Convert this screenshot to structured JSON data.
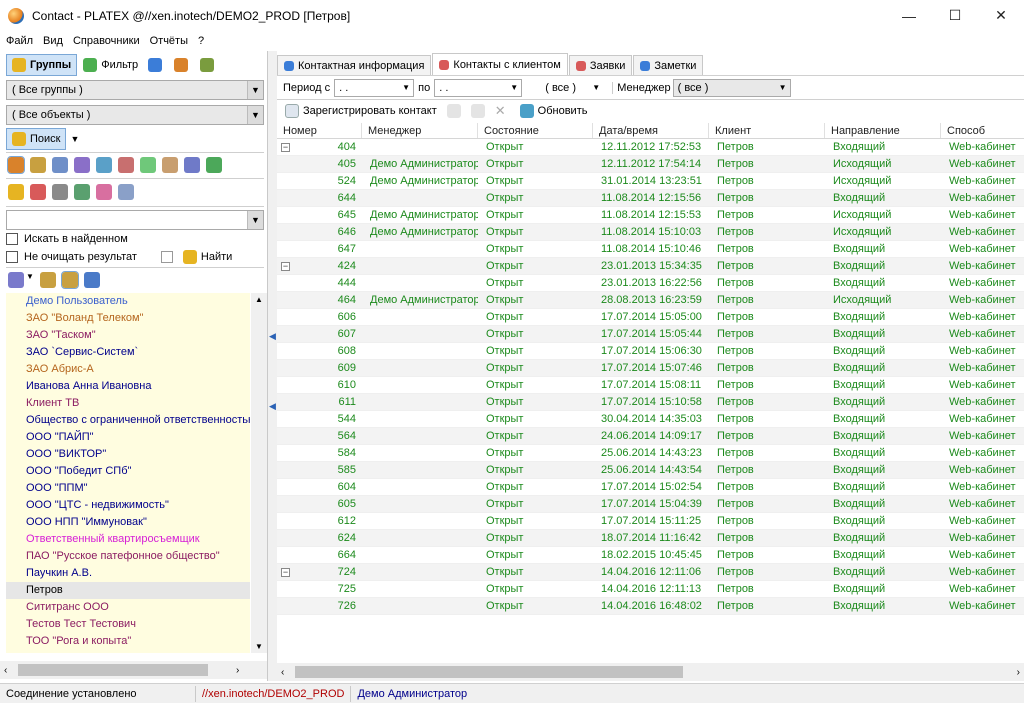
{
  "window": {
    "title": "Contact - PLATEX @//xen.inotech/DEMO2_PROD [Петров]"
  },
  "menu": [
    "Файл",
    "Вид",
    "Справочники",
    "Отчёты",
    "?"
  ],
  "left": {
    "groups_btn": "Группы",
    "filter_btn": "Фильтр",
    "all_groups": "( Все группы )",
    "all_objects": "( Все объекты )",
    "search_btn": "Поиск",
    "search_in_found": "Искать в найденном",
    "no_clear": "Не очищать результат",
    "find_btn": "Найти",
    "clients": [
      {
        "name": "Демо Пользователь",
        "color": "#3a5fcd"
      },
      {
        "name": "ЗАО \"Воланд Телеком\"",
        "color": "#b5651d"
      },
      {
        "name": "ЗАО \"Таском\"",
        "color": "#8b1c62"
      },
      {
        "name": "ЗАО `Сервис-Систем`",
        "color": "#00008b"
      },
      {
        "name": "ЗАО Абрис-А",
        "color": "#b5651d"
      },
      {
        "name": "Иванова Анна Ивановна",
        "color": "#00008b"
      },
      {
        "name": "Клиент ТВ",
        "color": "#8b1c62"
      },
      {
        "name": "Общество с ограниченной ответственностью Сме",
        "color": "#00008b"
      },
      {
        "name": "ООО  \"ПАЙП\"",
        "color": "#00008b"
      },
      {
        "name": "ООО \"ВИКТОР\"",
        "color": "#00008b"
      },
      {
        "name": "ООО \"Победит СПб\"",
        "color": "#00008b"
      },
      {
        "name": "ООО \"ППМ\"",
        "color": "#00008b"
      },
      {
        "name": "ООО \"ЦТС - недвижимость\"",
        "color": "#00008b"
      },
      {
        "name": "ООО НПП \"Иммуновак\"",
        "color": "#00008b"
      },
      {
        "name": "Ответственный квартиросъемщик",
        "color": "#d61fd6"
      },
      {
        "name": "ПАО \"Русское патефонное общество\"",
        "color": "#8b1c62"
      },
      {
        "name": "Паучкин А.В.",
        "color": "#00008b"
      },
      {
        "name": "Петров",
        "color": "#000000",
        "selected": true
      },
      {
        "name": "Сититранс ООО",
        "color": "#8b1c62"
      },
      {
        "name": "Тестов Тест Тестович",
        "color": "#8b1c62"
      },
      {
        "name": "ТОО \"Рога и копыта\"",
        "color": "#8b1c62"
      }
    ]
  },
  "tabs": [
    "Контактная информация",
    "Контакты с клиентом",
    "Заявки",
    "Заметки"
  ],
  "filter": {
    "period_label": "Период с",
    "period_from": ". .",
    "to_label": "по",
    "period_to": ". .",
    "all_value": "( все )",
    "manager_label": "Менеджер",
    "manager_value": "( все )"
  },
  "actions": {
    "register": "Зарегистрировать контакт",
    "refresh": "Обновить"
  },
  "grid": {
    "columns": [
      "Номер",
      "Менеджер",
      "Состояние",
      "Дата/время",
      "Клиент",
      "Направление",
      "Способ"
    ],
    "rows": [
      {
        "n": "404",
        "m": "",
        "s": "Открыт",
        "d": "12.11.2012 17:52:53",
        "c": "Петров",
        "dir": "Входящий",
        "way": "Web-кабинет",
        "group": true
      },
      {
        "n": "405",
        "m": "Демо Администратор",
        "s": "Открыт",
        "d": "12.11.2012 17:54:14",
        "c": "Петров",
        "dir": "Исходящий",
        "way": "Web-кабинет"
      },
      {
        "n": "524",
        "m": "Демо Администратор",
        "s": "Открыт",
        "d": "31.01.2014 13:23:51",
        "c": "Петров",
        "dir": "Исходящий",
        "way": "Web-кабинет"
      },
      {
        "n": "644",
        "m": "",
        "s": "Открыт",
        "d": "11.08.2014 12:15:56",
        "c": "Петров",
        "dir": "Входящий",
        "way": "Web-кабинет"
      },
      {
        "n": "645",
        "m": "Демо Администратор",
        "s": "Открыт",
        "d": "11.08.2014 12:15:53",
        "c": "Петров",
        "dir": "Исходящий",
        "way": "Web-кабинет"
      },
      {
        "n": "646",
        "m": "Демо Администратор",
        "s": "Открыт",
        "d": "11.08.2014 15:10:03",
        "c": "Петров",
        "dir": "Исходящий",
        "way": "Web-кабинет"
      },
      {
        "n": "647",
        "m": "",
        "s": "Открыт",
        "d": "11.08.2014 15:10:46",
        "c": "Петров",
        "dir": "Входящий",
        "way": "Web-кабинет"
      },
      {
        "n": "424",
        "m": "",
        "s": "Открыт",
        "d": "23.01.2013 15:34:35",
        "c": "Петров",
        "dir": "Входящий",
        "way": "Web-кабинет",
        "group": true
      },
      {
        "n": "444",
        "m": "",
        "s": "Открыт",
        "d": "23.01.2013 16:22:56",
        "c": "Петров",
        "dir": "Входящий",
        "way": "Web-кабинет"
      },
      {
        "n": "464",
        "m": "Демо Администратор",
        "s": "Открыт",
        "d": "28.08.2013 16:23:59",
        "c": "Петров",
        "dir": "Исходящий",
        "way": "Web-кабинет"
      },
      {
        "n": "606",
        "m": "",
        "s": "Открыт",
        "d": "17.07.2014 15:05:00",
        "c": "Петров",
        "dir": "Входящий",
        "way": "Web-кабинет"
      },
      {
        "n": "607",
        "m": "",
        "s": "Открыт",
        "d": "17.07.2014 15:05:44",
        "c": "Петров",
        "dir": "Входящий",
        "way": "Web-кабинет"
      },
      {
        "n": "608",
        "m": "",
        "s": "Открыт",
        "d": "17.07.2014 15:06:30",
        "c": "Петров",
        "dir": "Входящий",
        "way": "Web-кабинет"
      },
      {
        "n": "609",
        "m": "",
        "s": "Открыт",
        "d": "17.07.2014 15:07:46",
        "c": "Петров",
        "dir": "Входящий",
        "way": "Web-кабинет"
      },
      {
        "n": "610",
        "m": "",
        "s": "Открыт",
        "d": "17.07.2014 15:08:11",
        "c": "Петров",
        "dir": "Входящий",
        "way": "Web-кабинет"
      },
      {
        "n": "611",
        "m": "",
        "s": "Открыт",
        "d": "17.07.2014 15:10:58",
        "c": "Петров",
        "dir": "Входящий",
        "way": "Web-кабинет"
      },
      {
        "n": "544",
        "m": "",
        "s": "Открыт",
        "d": "30.04.2014 14:35:03",
        "c": "Петров",
        "dir": "Входящий",
        "way": "Web-кабинет"
      },
      {
        "n": "564",
        "m": "",
        "s": "Открыт",
        "d": "24.06.2014 14:09:17",
        "c": "Петров",
        "dir": "Входящий",
        "way": "Web-кабинет"
      },
      {
        "n": "584",
        "m": "",
        "s": "Открыт",
        "d": "25.06.2014 14:43:23",
        "c": "Петров",
        "dir": "Входящий",
        "way": "Web-кабинет"
      },
      {
        "n": "585",
        "m": "",
        "s": "Открыт",
        "d": "25.06.2014 14:43:54",
        "c": "Петров",
        "dir": "Входящий",
        "way": "Web-кабинет"
      },
      {
        "n": "604",
        "m": "",
        "s": "Открыт",
        "d": "17.07.2014 15:02:54",
        "c": "Петров",
        "dir": "Входящий",
        "way": "Web-кабинет"
      },
      {
        "n": "605",
        "m": "",
        "s": "Открыт",
        "d": "17.07.2014 15:04:39",
        "c": "Петров",
        "dir": "Входящий",
        "way": "Web-кабинет"
      },
      {
        "n": "612",
        "m": "",
        "s": "Открыт",
        "d": "17.07.2014 15:11:25",
        "c": "Петров",
        "dir": "Входящий",
        "way": "Web-кабинет"
      },
      {
        "n": "624",
        "m": "",
        "s": "Открыт",
        "d": "18.07.2014 11:16:42",
        "c": "Петров",
        "dir": "Входящий",
        "way": "Web-кабинет"
      },
      {
        "n": "664",
        "m": "",
        "s": "Открыт",
        "d": "18.02.2015 10:45:45",
        "c": "Петров",
        "dir": "Входящий",
        "way": "Web-кабинет"
      },
      {
        "n": "724",
        "m": "",
        "s": "Открыт",
        "d": "14.04.2016 12:11:06",
        "c": "Петров",
        "dir": "Входящий",
        "way": "Web-кабинет",
        "group": true
      },
      {
        "n": "725",
        "m": "",
        "s": "Открыт",
        "d": "14.04.2016 12:11:13",
        "c": "Петров",
        "dir": "Входящий",
        "way": "Web-кабинет"
      },
      {
        "n": "726",
        "m": "",
        "s": "Открыт",
        "d": "14.04.2016 16:48:02",
        "c": "Петров",
        "dir": "Входящий",
        "way": "Web-кабинет"
      }
    ]
  },
  "status": {
    "connection": "Соединение установлено",
    "db": "//xen.inotech/DEMO2_PROD",
    "user": "Демо Администратор",
    "db_color": "#b00000",
    "user_color": "#00008b"
  },
  "colors": {
    "grid_text": "#1c8a1c",
    "selection": "#cfe3f7",
    "list_bg": "#fffde0"
  }
}
